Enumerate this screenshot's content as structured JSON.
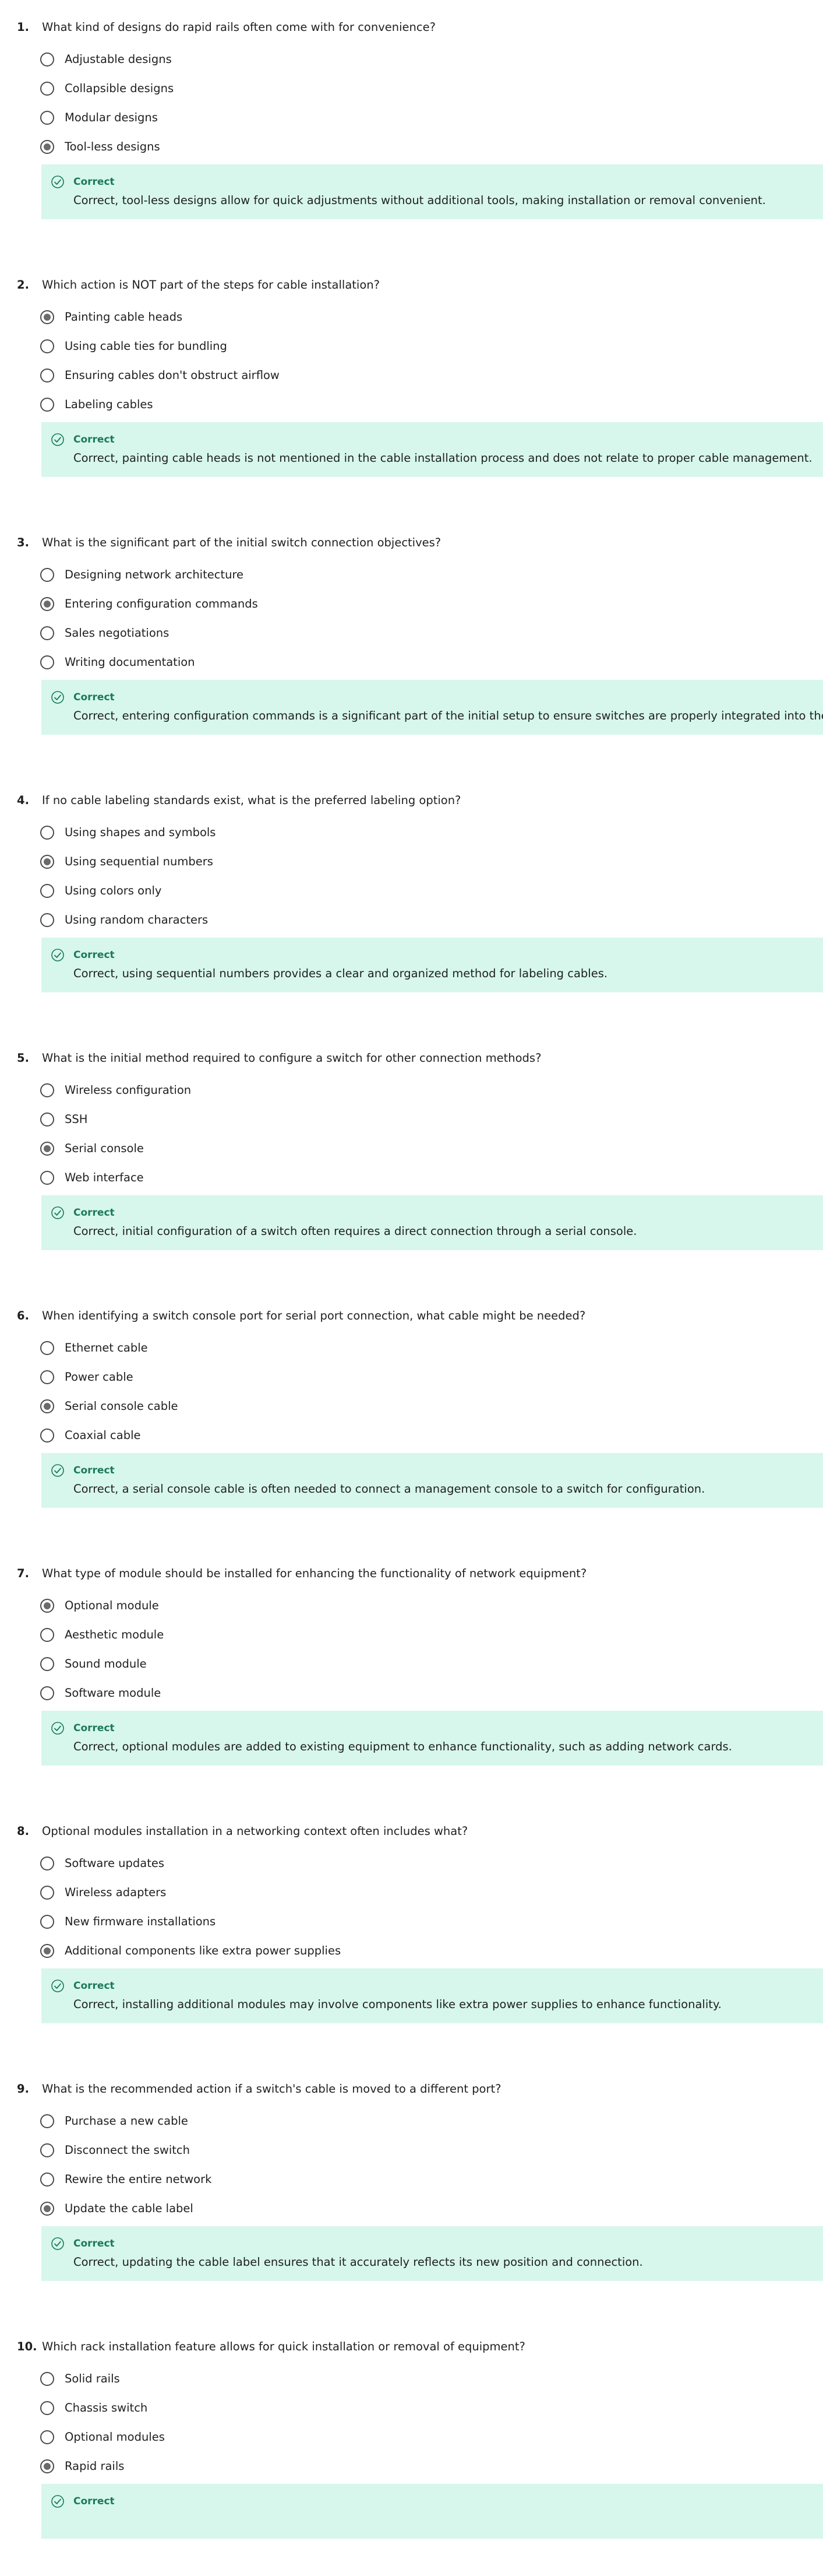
{
  "feedback_status": "Correct",
  "colors": {
    "feedback_bg": "#d7f7ec",
    "correct_green": "#1b7a57",
    "radio_border": "#4a4a4a"
  },
  "icons": {
    "feedback": "check-circle-icon"
  },
  "questions": [
    {
      "number": "1.",
      "text": "What kind of designs do rapid rails often come with for convenience?",
      "options": [
        "Adjustable designs",
        "Collapsible designs",
        "Modular designs",
        "Tool-less designs"
      ],
      "selected": 3,
      "feedback": "Correct, tool-less designs allow for quick adjustments without additional tools, making installation or removal convenient."
    },
    {
      "number": "2.",
      "text": "Which action is NOT part of the steps for cable installation?",
      "options": [
        "Painting cable heads",
        "Using cable ties for bundling",
        "Ensuring cables don't obstruct airflow",
        "Labeling cables"
      ],
      "selected": 0,
      "feedback": "Correct, painting cable heads is not mentioned in the cable installation process and does not relate to proper cable management."
    },
    {
      "number": "3.",
      "text": "What is the significant part of the initial switch connection objectives?",
      "options": [
        "Designing network architecture",
        "Entering configuration commands",
        "Sales negotiations",
        "Writing documentation"
      ],
      "selected": 1,
      "feedback": "Correct, entering configuration commands is a significant part of the initial setup to ensure switches are properly integrated into the network."
    },
    {
      "number": "4.",
      "text": "If no cable labeling standards exist, what is the preferred labeling option?",
      "options": [
        "Using shapes and symbols",
        "Using sequential numbers",
        "Using colors only",
        "Using random characters"
      ],
      "selected": 1,
      "feedback": "Correct, using sequential numbers provides a clear and organized method for labeling cables."
    },
    {
      "number": "5.",
      "text": "What is the initial method required to configure a switch for other connection methods?",
      "options": [
        "Wireless configuration",
        "SSH",
        "Serial console",
        "Web interface"
      ],
      "selected": 2,
      "feedback": "Correct, initial configuration of a switch often requires a direct connection through a serial console."
    },
    {
      "number": "6.",
      "text": "When identifying a switch console port for serial port connection, what cable might be needed?",
      "options": [
        "Ethernet cable",
        "Power cable",
        "Serial console cable",
        "Coaxial cable"
      ],
      "selected": 2,
      "feedback": "Correct, a serial console cable is often needed to connect a management console to a switch for configuration."
    },
    {
      "number": "7.",
      "text": "What type of module should be installed for enhancing the functionality of network equipment?",
      "options": [
        "Optional module",
        "Aesthetic module",
        "Sound module",
        "Software module"
      ],
      "selected": 0,
      "feedback": "Correct, optional modules are added to existing equipment to enhance functionality, such as adding network cards."
    },
    {
      "number": "8.",
      "text": "Optional modules installation in a networking context often includes what?",
      "options": [
        "Software updates",
        "Wireless adapters",
        "New firmware installations",
        "Additional components like extra power supplies"
      ],
      "selected": 3,
      "feedback": "Correct, installing additional modules may involve components like extra power supplies to enhance functionality."
    },
    {
      "number": "9.",
      "text": "What is the recommended action if a switch's cable is moved to a different port?",
      "options": [
        "Purchase a new cable",
        "Disconnect the switch",
        "Rewire the entire network",
        "Update the cable label"
      ],
      "selected": 3,
      "feedback": "Correct, updating the cable label ensures that it accurately reflects its new position and connection."
    },
    {
      "number": "10.",
      "text": "Which rack installation feature allows for quick installation or removal of equipment?",
      "options": [
        "Solid rails",
        "Chassis switch",
        "Optional modules",
        "Rapid rails"
      ],
      "selected": 3,
      "feedback": ""
    }
  ]
}
